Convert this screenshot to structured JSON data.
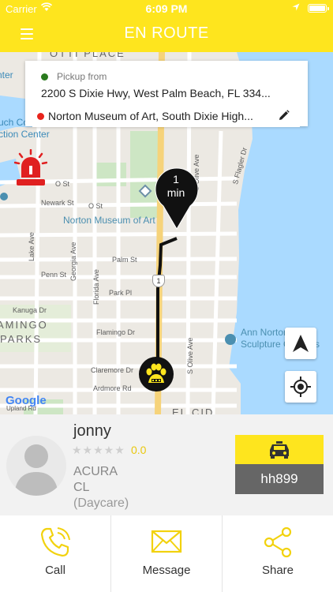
{
  "status_bar": {
    "carrier": "Carrier",
    "time": "6:09 PM"
  },
  "header": {
    "title": "EN ROUTE",
    "menu_icon": "hamburger-icon"
  },
  "trip": {
    "pickup_label": "Pickup from",
    "pickup_address": "2200 S Dixie Hwy,  West Palm Beach,  FL 334...",
    "dropoff_address": "Norton Museum of Art, South Dixie High...",
    "eta_value": "1",
    "eta_unit": "min"
  },
  "map": {
    "labels": {
      "olive_ave": "S Olive Ave",
      "flagler_dr": "S Flagler Dr",
      "dixie_hwy": "S Dixie Hwy",
      "o_st": "O St",
      "newark_st": "Newark St",
      "palm_st": "Palm St",
      "penn_st": "Penn St",
      "park_pl": "Park Pl",
      "kanuga_dr": "Kanuga Dr",
      "flamingo_dr": "Flamingo Dr",
      "claremore_dr": "Claremore Dr",
      "ardmore_rd": "Ardmore Rd",
      "lake_ave": "Lake Ave",
      "georgia_ave": "Georgia Ave",
      "florida_ave": "Florida Ave",
      "museum": "Norton Museum of Art",
      "ann_norton": "Ann Norton",
      "ann_norton_2": "Sculpture Gardens",
      "flamingo_parks_1": "AMINGO",
      "flamingo_parks_2": "PARKS",
      "el_cid": "EL CID",
      "upland": "Upland Rd",
      "ntr": "nter",
      "uch": "uch Col",
      "ction": "ction Center",
      "route_shield": "1",
      "top_label": "OTTI PLACE"
    },
    "google_logo": "Google"
  },
  "driver": {
    "name": "jonny",
    "stars": "★★★★★",
    "rating": "0.0",
    "car_make": "ACURA",
    "car_model": "CL",
    "car_type": "(Daycare)",
    "plate": "hh899"
  },
  "actions": [
    {
      "label": "Call",
      "icon": "phone-icon"
    },
    {
      "label": "Message",
      "icon": "envelope-icon"
    },
    {
      "label": "Share",
      "icon": "share-icon"
    }
  ],
  "colors": {
    "brand_yellow": "#FEE51E",
    "pickup_green": "#2a7a1e",
    "dropoff_red": "#e8241c",
    "route_black": "#111111",
    "water_blue": "#AADAFF"
  }
}
